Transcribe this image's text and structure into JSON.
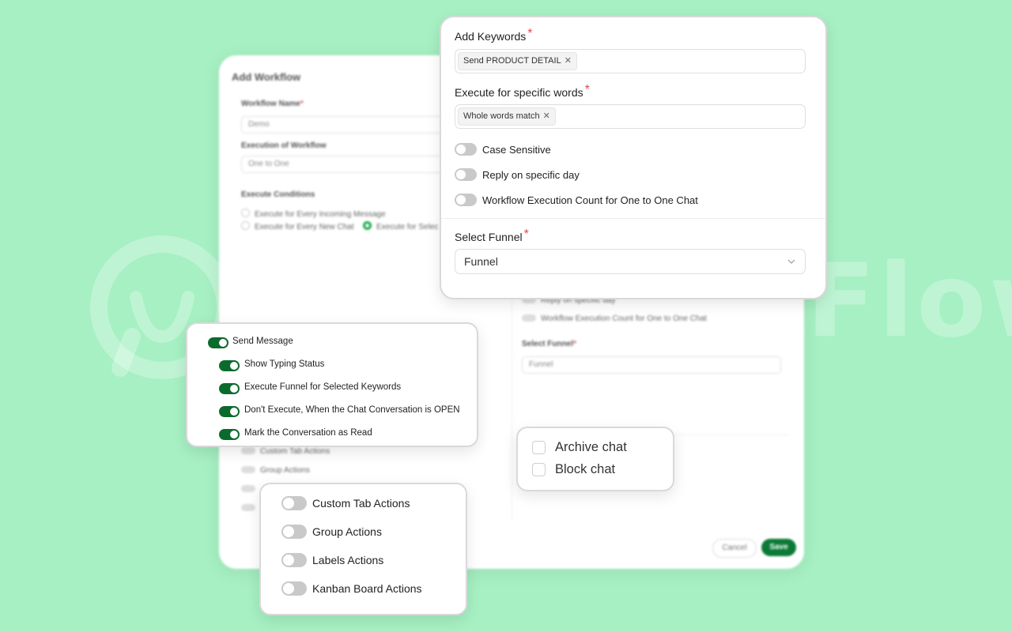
{
  "watermark": {
    "text": "WA WorkFlow"
  },
  "base_window": {
    "title": "Add Workflow",
    "workflow_name_label": "Workflow Name",
    "workflow_name_value": "Demo",
    "execution_label": "Execution of Workflow",
    "execution_value": "One to One",
    "conditions_label": "Execute Conditions",
    "condition_options": [
      "Execute for Every Incoming Message",
      "Execute for Every New Chat",
      "Execute for Selec"
    ],
    "bg_toggle_labels": [
      "Reply on specific day",
      "Workflow Execution Count for One to One Chat",
      "Custom Tab Actions",
      "Group Actions"
    ],
    "select_funnel_label": "Select Funnel",
    "select_funnel_value": "Funnel",
    "cancel_label": "Cancel",
    "save_label": "Save"
  },
  "keywords_card": {
    "add_keywords_label": "Add Keywords",
    "keyword_tags": [
      "Send PRODUCT DETAIL"
    ],
    "specific_words_label": "Execute for specific words",
    "specific_words_tags": [
      "Whole words match"
    ],
    "toggles": [
      {
        "label": "Case Sensitive",
        "on": false
      },
      {
        "label": "Reply on specific day",
        "on": false
      },
      {
        "label": "Workflow Execution Count for One to One Chat",
        "on": false
      }
    ],
    "select_funnel_label": "Select Funnel",
    "select_funnel_value": "Funnel",
    "required_mark": "*"
  },
  "actions_card": {
    "toggles": [
      {
        "label": "Send Message",
        "on": true
      },
      {
        "label": "Show Typing Status",
        "on": true
      },
      {
        "label": "Execute Funnel for Selected Keywords",
        "on": true
      },
      {
        "label": "Don't Execute, When the Chat Conversation is OPEN",
        "on": true
      },
      {
        "label": "Mark the Conversation as Read",
        "on": true
      }
    ],
    "toggle_color": "#0b6b2d"
  },
  "checkbox_card": {
    "items": [
      {
        "label": "Archive chat",
        "checked": false
      },
      {
        "label": "Block chat",
        "checked": false
      }
    ]
  },
  "bottom_toggles_card": {
    "toggles": [
      {
        "label": "Custom Tab Actions",
        "on": false
      },
      {
        "label": "Group Actions",
        "on": false
      },
      {
        "label": "Labels Actions",
        "on": false
      },
      {
        "label": "Kanban Board Actions",
        "on": false
      }
    ]
  },
  "colors": {
    "background": "#a6f0c3",
    "accent_green": "#0b6b2d",
    "required": "#e5484d"
  }
}
